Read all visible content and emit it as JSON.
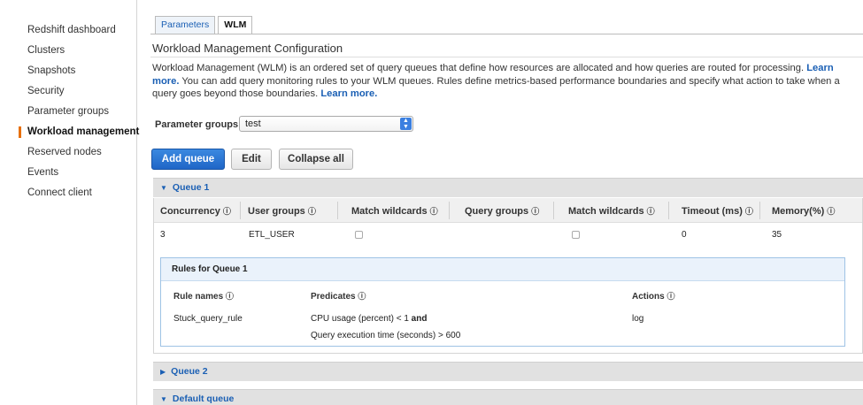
{
  "sidebar": {
    "items": [
      {
        "label": "Redshift dashboard",
        "active": false
      },
      {
        "label": "Clusters",
        "active": false
      },
      {
        "label": "Snapshots",
        "active": false
      },
      {
        "label": "Security",
        "active": false
      },
      {
        "label": "Parameter groups",
        "active": false
      },
      {
        "label": "Workload management",
        "active": true
      },
      {
        "label": "Reserved nodes",
        "active": false
      },
      {
        "label": "Events",
        "active": false
      },
      {
        "label": "Connect client",
        "active": false
      }
    ],
    "accent_color": "#e7700d"
  },
  "tabs": [
    {
      "label": "Parameters",
      "active": false
    },
    {
      "label": "WLM",
      "active": true
    }
  ],
  "section": {
    "title": "Workload Management Configuration",
    "desc_part1": "Workload Management (WLM) is an ordered set of query queues that define how resources are allocated and how queries are routed for processing.",
    "learn_more_1": "Learn more.",
    "desc_part2": "You can add query monitoring rules to your WLM queues. Rules define metrics-based performance boundaries and specify what action to take when a query goes beyond those boundaries.",
    "learn_more_2": "Learn more."
  },
  "parameter_groups": {
    "label": "Parameter groups",
    "selected": "test"
  },
  "buttons": {
    "add_queue": "Add queue",
    "edit": "Edit",
    "collapse_all": "Collapse all"
  },
  "queues": [
    {
      "label": "Queue 1",
      "expanded": true
    },
    {
      "label": "Queue 2",
      "expanded": false
    },
    {
      "label": "Default queue",
      "expanded": true
    }
  ],
  "queue_table": {
    "headers": [
      "Concurrency",
      "User groups",
      "Match wildcards",
      "Query groups",
      "Match wildcards",
      "Timeout (ms)",
      "Memory(%)"
    ],
    "row": {
      "concurrency": "3",
      "user_groups": "ETL_USER",
      "match_wildcards_1": false,
      "query_groups": "",
      "match_wildcards_2": false,
      "timeout": "0",
      "memory": "35"
    }
  },
  "rules": {
    "title": "Rules for Queue 1",
    "headers": [
      "Rule names",
      "Predicates",
      "Actions"
    ],
    "rule": {
      "name": "Stuck_query_rule",
      "predicate_1": "CPU usage (percent) < 1",
      "predicate_joiner": "and",
      "predicate_2": "Query execution time (seconds) > 600",
      "action": "log"
    }
  },
  "icons": {
    "info": "info-icon",
    "caret_down": "caret-down-icon",
    "caret_right": "caret-right-icon",
    "select_arrows": "select-arrows-icon"
  },
  "colors": {
    "link": "#1a5fb4",
    "primary_button": "#1f66c7",
    "queue_bar": "#e1e1e1",
    "rules_border": "#9fc3e5"
  }
}
